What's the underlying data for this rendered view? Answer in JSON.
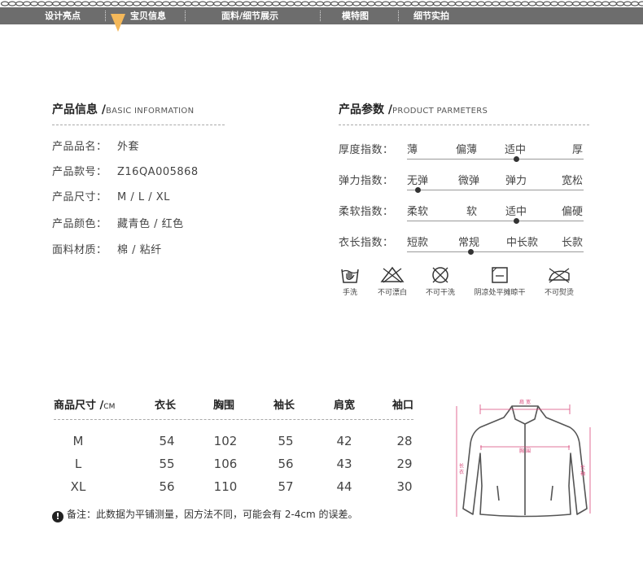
{
  "nav": {
    "items": [
      "设计亮点",
      "宝贝信息",
      "面料/细节展示",
      "模特图",
      "细节实拍"
    ],
    "active_index": 1,
    "bar_color": "#6d6d6d",
    "marker_color": "#f4b85a"
  },
  "info": {
    "title": "产品信息 /",
    "subtitle": "BASIC INFORMATION",
    "rows": [
      {
        "label": "产品品名：",
        "value": "外套"
      },
      {
        "label": "产品款号：",
        "value": "Z16QA005868"
      },
      {
        "label": "产品尺寸：",
        "value": "M / L / XL"
      },
      {
        "label": "产品颜色：",
        "value": "藏青色 / 红色"
      },
      {
        "label": "面料材质：",
        "value": "棉 / 粘纤"
      }
    ]
  },
  "params": {
    "title": "产品参数 /",
    "subtitle": "PRODUCT PARMETERS",
    "rows": [
      {
        "label": "厚度指数：",
        "options": [
          "薄",
          "偏薄",
          "适中",
          "厚"
        ],
        "selected": 2
      },
      {
        "label": "弹力指数：",
        "options": [
          "无弹",
          "微弹",
          "弹力",
          "宽松"
        ],
        "selected": 0
      },
      {
        "label": "柔软指数：",
        "options": [
          "柔软",
          "软",
          "适中",
          "偏硬"
        ],
        "selected": 2
      },
      {
        "label": "衣长指数：",
        "options": [
          "短款",
          "常规",
          "中长款",
          "长款"
        ],
        "selected": 1
      }
    ]
  },
  "care": [
    {
      "icon": "hand-wash-icon",
      "label": "手洗"
    },
    {
      "icon": "no-bleach-icon",
      "label": "不可漂白"
    },
    {
      "icon": "no-dry-clean-icon",
      "label": "不可干洗"
    },
    {
      "icon": "dry-flat-shade-icon",
      "label": "阴凉处平摊晾干"
    },
    {
      "icon": "no-iron-icon",
      "label": "不可熨烫"
    }
  ],
  "size_table": {
    "header_label": "商品尺寸 /",
    "header_unit": "CM",
    "columns": [
      "衣长",
      "胸围",
      "袖长",
      "肩宽",
      "袖口"
    ],
    "rows": [
      {
        "size": "M",
        "values": [
          "54",
          "102",
          "55",
          "42",
          "28"
        ]
      },
      {
        "size": "L",
        "values": [
          "55",
          "106",
          "56",
          "43",
          "29"
        ]
      },
      {
        "size": "XL",
        "values": [
          "56",
          "110",
          "57",
          "44",
          "30"
        ]
      }
    ],
    "note": "备注：此数据为平铺测量，因方法不同，可能会有 2-4cm 的误差。"
  },
  "diagram": {
    "shoulder": "肩 宽",
    "chest": "胸 围",
    "length": "长 衣",
    "sleeve": "长 袖",
    "line_color": "#d9477a"
  }
}
